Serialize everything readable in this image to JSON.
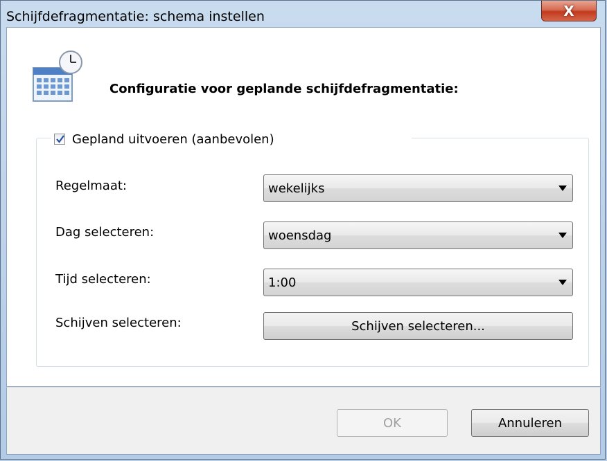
{
  "window": {
    "title": "Schijfdefragmentatie: schema instellen",
    "close_label": "X"
  },
  "header": {
    "icon": "calendar-clock-icon",
    "heading": "Configuratie voor geplande schijfdefragmentatie:"
  },
  "schedule": {
    "checkbox_label": "Gepland uitvoeren (aanbevolen)",
    "checkbox_checked": true,
    "frequency_label": "Regelmaat:",
    "frequency_value": "wekelijks",
    "day_label": "Dag selecteren:",
    "day_value": "woensdag",
    "time_label": "Tijd selecteren:",
    "time_value": "1:00",
    "disks_label": "Schijven selecteren:",
    "disks_button": "Schijven selecteren..."
  },
  "footer": {
    "ok_label": "OK",
    "ok_enabled": false,
    "cancel_label": "Annuleren"
  },
  "colors": {
    "close_red": "#c2391e",
    "frame_blue": "#bed3ea",
    "check_blue": "#2a4f9e"
  }
}
